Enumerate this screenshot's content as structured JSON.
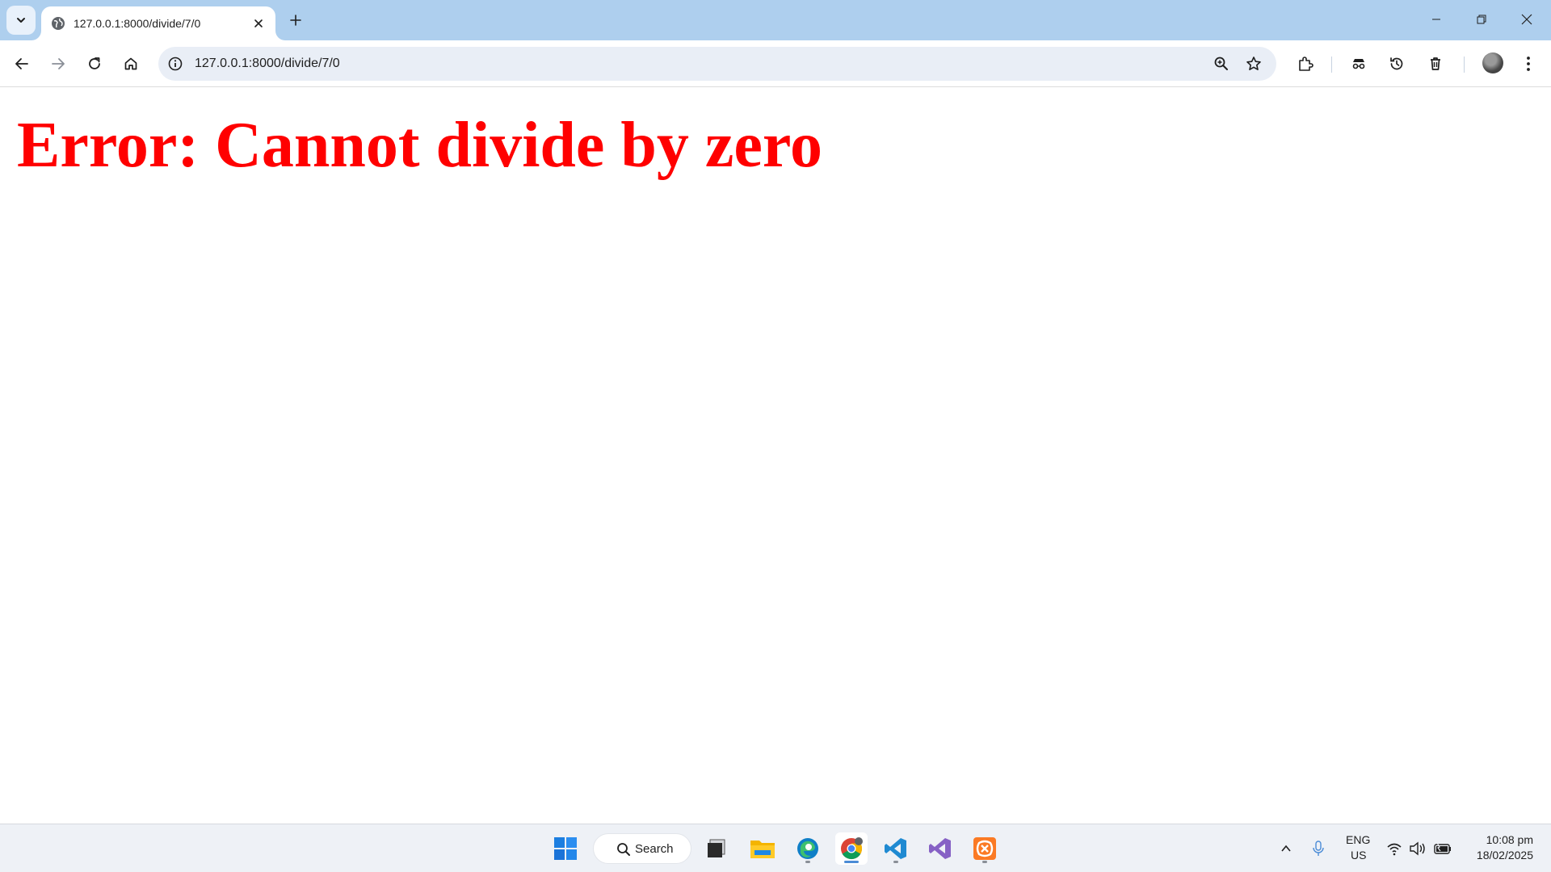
{
  "browser": {
    "tab": {
      "title": "127.0.0.1:8000/divide/7/0",
      "favicon": "globe-icon"
    },
    "address_bar": {
      "url": "127.0.0.1:8000/divide/7/0"
    },
    "toolbar_icons": [
      "back-icon",
      "forward-icon",
      "reload-icon",
      "home-icon",
      "site-info-icon",
      "zoom-icon",
      "bookmark-star-icon",
      "extensions-icon",
      "incognito-icon",
      "history-icon",
      "delete-icon",
      "avatar",
      "menu-icon"
    ]
  },
  "page": {
    "heading": "Error: Cannot divide by zero",
    "heading_color": "#ff0000"
  },
  "taskbar": {
    "search_label": "Search",
    "apps": [
      "windows-start-icon",
      "task-view-icon",
      "file-explorer-icon",
      "edge-icon",
      "chrome-icon",
      "vscode-icon",
      "visual-studio-icon",
      "xampp-icon"
    ],
    "tray": {
      "lang_line1": "ENG",
      "lang_line2": "US",
      "time": "10:08 pm",
      "date": "18/02/2025"
    }
  },
  "colors": {
    "tabstrip": "#aecfee",
    "omnibox": "#e9eef6",
    "error": "#ff0000"
  }
}
